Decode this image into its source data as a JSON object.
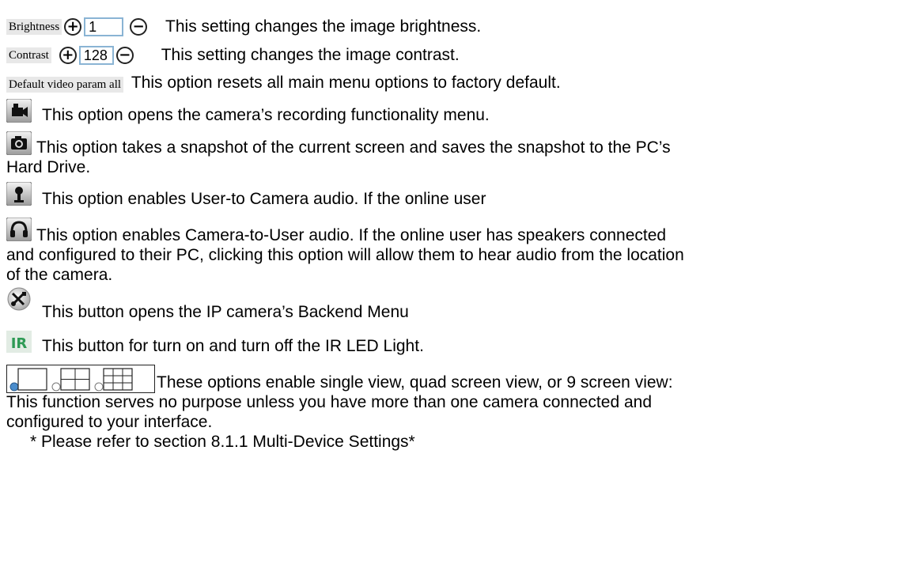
{
  "brightness": {
    "label": "Brightness",
    "plus": "+",
    "value": "1",
    "minus": "−",
    "desc": "This setting changes the image brightness."
  },
  "contrast": {
    "label": "Contrast",
    "plus": "+",
    "value": "128",
    "minus": "−",
    "desc": "This setting changes the image contrast."
  },
  "default_param": {
    "label": "Default video param all",
    "desc": "This option resets all main menu options to factory default."
  },
  "record": {
    "icon": "video-camera-icon",
    "desc": "This option opens the camera’s recording functionality menu."
  },
  "snapshot": {
    "icon": "photo-camera-icon",
    "desc_line1": "This option takes a snapshot of the current screen and saves the snapshot to the PC’s",
    "desc_line2": "Hard Drive."
  },
  "mic": {
    "icon": "microphone-icon",
    "desc": "This option enables User-to Camera audio. If the online user"
  },
  "audio": {
    "icon": "headphones-icon",
    "desc_line1": "This option enables Camera-to-User audio. If the online user has speakers connected",
    "desc_line2": "and configured to their PC, clicking this option will allow them to hear audio from the location",
    "desc_line3": "of the camera."
  },
  "backend": {
    "icon": "tools-icon",
    "desc": "This button opens the IP camera’s Backend Menu"
  },
  "ir": {
    "icon_text": "IR",
    "desc": "This button for turn on and turn off the IR LED Light."
  },
  "views": {
    "icons": [
      "single-view-icon",
      "quad-view-icon",
      "nine-view-icon"
    ],
    "desc_line1": "These options enable single view, quad screen view, or 9 screen view:",
    "desc_line2": "This function serves no purpose unless you have more than one camera connected and",
    "desc_line3": "configured to your interface."
  },
  "note": "* Please refer to section 8.1.1 Multi-Device Settings*"
}
